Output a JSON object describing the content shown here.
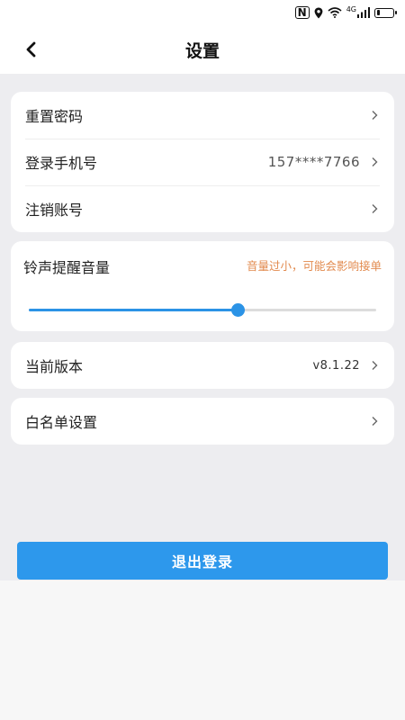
{
  "status_bar": {
    "nfc_label": "N",
    "network_label": "4G",
    "battery_level": 0.2,
    "icons": [
      "nfc-icon",
      "location-icon",
      "wifi-icon",
      "cellular-signal-icon",
      "battery-icon"
    ]
  },
  "header": {
    "title": "设置",
    "back_icon": "chevron-left-icon"
  },
  "account_section": {
    "items": [
      {
        "label": "重置密码",
        "value": ""
      },
      {
        "label": "登录手机号",
        "value": "157****7766"
      },
      {
        "label": "注销账号",
        "value": ""
      }
    ]
  },
  "ringtone": {
    "label": "铃声提醒音量",
    "warning": "音量过小，可能会影响接单",
    "volume_fraction": 0.6
  },
  "version": {
    "label": "当前版本",
    "value": "v8.1.22"
  },
  "whitelist": {
    "label": "白名单设置"
  },
  "logout_label": "退出登录",
  "colors": {
    "accent": "#2d98ec",
    "warning": "#e28a4e",
    "page_bg": "#ededf0"
  }
}
